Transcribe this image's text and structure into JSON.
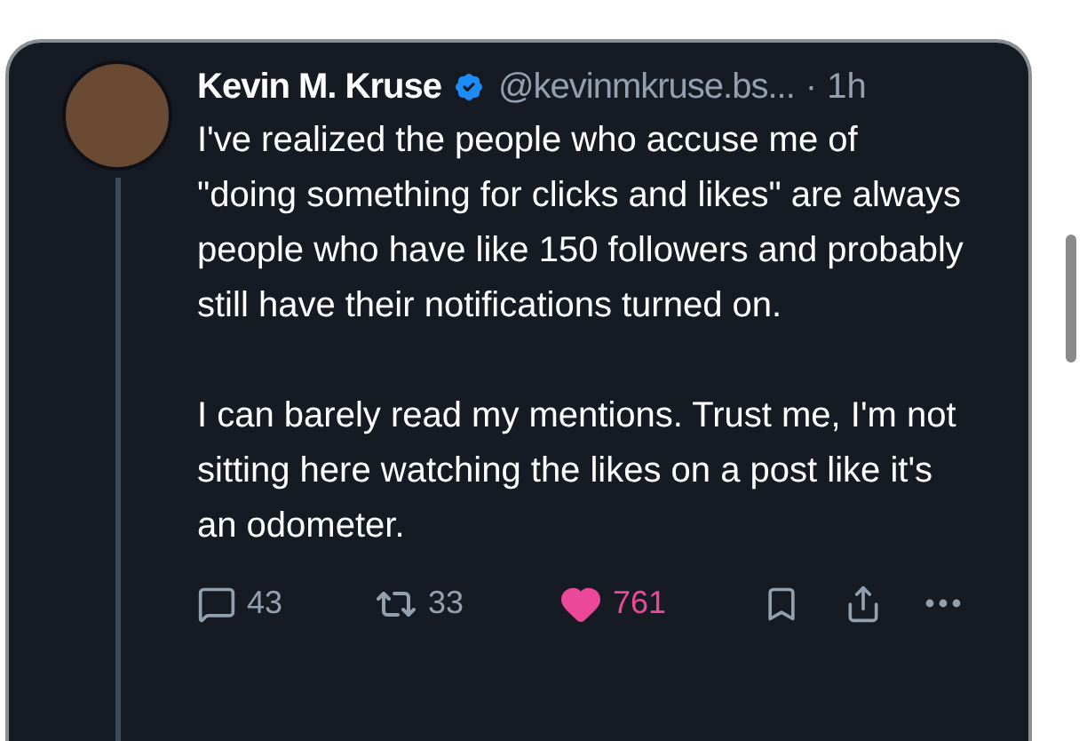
{
  "post": {
    "author": "Kevin M. Kruse",
    "verified": true,
    "handle": "@kevinmkruse.bs...",
    "time": "· 1h",
    "paragraphs": [
      "I've realized the people who accuse me of \"doing something for clicks and likes\" are always people who have like 150 followers and probably still have their notifications turned on.",
      "I can barely read my mentions. Trust me, I'm not sitting here watching the likes on a post like it's an odometer."
    ],
    "replies": "43",
    "reposts": "33",
    "likes": "761",
    "liked": true
  }
}
